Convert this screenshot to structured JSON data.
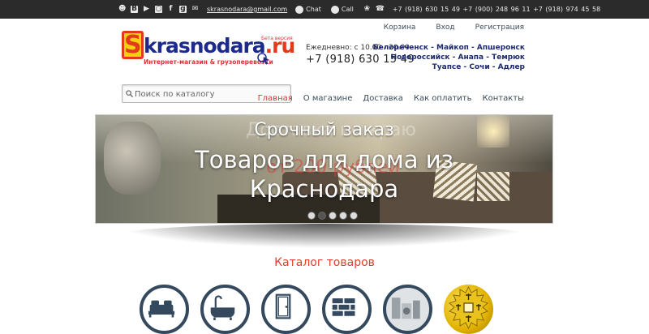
{
  "topbar": {
    "social_icons": [
      "odnoklassniki-icon",
      "vk-icon",
      "youtube-icon",
      "instagram-icon",
      "facebook-icon",
      "googleplus-icon"
    ],
    "email": "skrasnodara@gmail.com",
    "chat_label": "Chat",
    "call_label": "Call",
    "phones": "+7 (918) 630 15 49   +7 (900) 248 96 11   +7 (918) 974 45 58"
  },
  "header": {
    "logo_letter": "S",
    "logo_word": "krasnodara",
    "logo_tld": ".ru",
    "logo_beta": "Бета версия",
    "logo_tagline": "Интернет-магазин & грузоперевозки",
    "hours": "Ежедневно: с 10.00 - 20.00",
    "phone": "+7 (918) 630 15 49",
    "cities": [
      "Белореченск - Майкоп - Апшеронск",
      "Новороссийск - Анапа - Темрюк",
      "Туапсе - Сочи - Адлер"
    ],
    "user_nav": [
      "Корзина",
      "Вход",
      "Регистрация"
    ]
  },
  "search": {
    "placeholder": "Поиск по каталогу"
  },
  "main_nav": [
    "Главная",
    "О магазине",
    "Доставка",
    "Как оплатить",
    "Контакты"
  ],
  "slider": {
    "line1": "Срочный заказ",
    "line2": "Товаров для дома из",
    "line3": "Краснодара",
    "ghost_line1": "Доставка по краю",
    "ghost_line2": "от 200 рублей",
    "active_dot": 1,
    "dot_count": 5
  },
  "catalog": {
    "title": "Каталог товаров",
    "items": [
      "bed-icon",
      "bathtub-icon",
      "door-icon",
      "brick-icon",
      "appliances-icon",
      "feng-shui-coin-icon"
    ]
  },
  "colors": {
    "accent_red": "#e2402c",
    "nav_dark": "#34495e",
    "topbar_bg": "#2b2b2b",
    "logo_blue": "#1c2a8c"
  }
}
